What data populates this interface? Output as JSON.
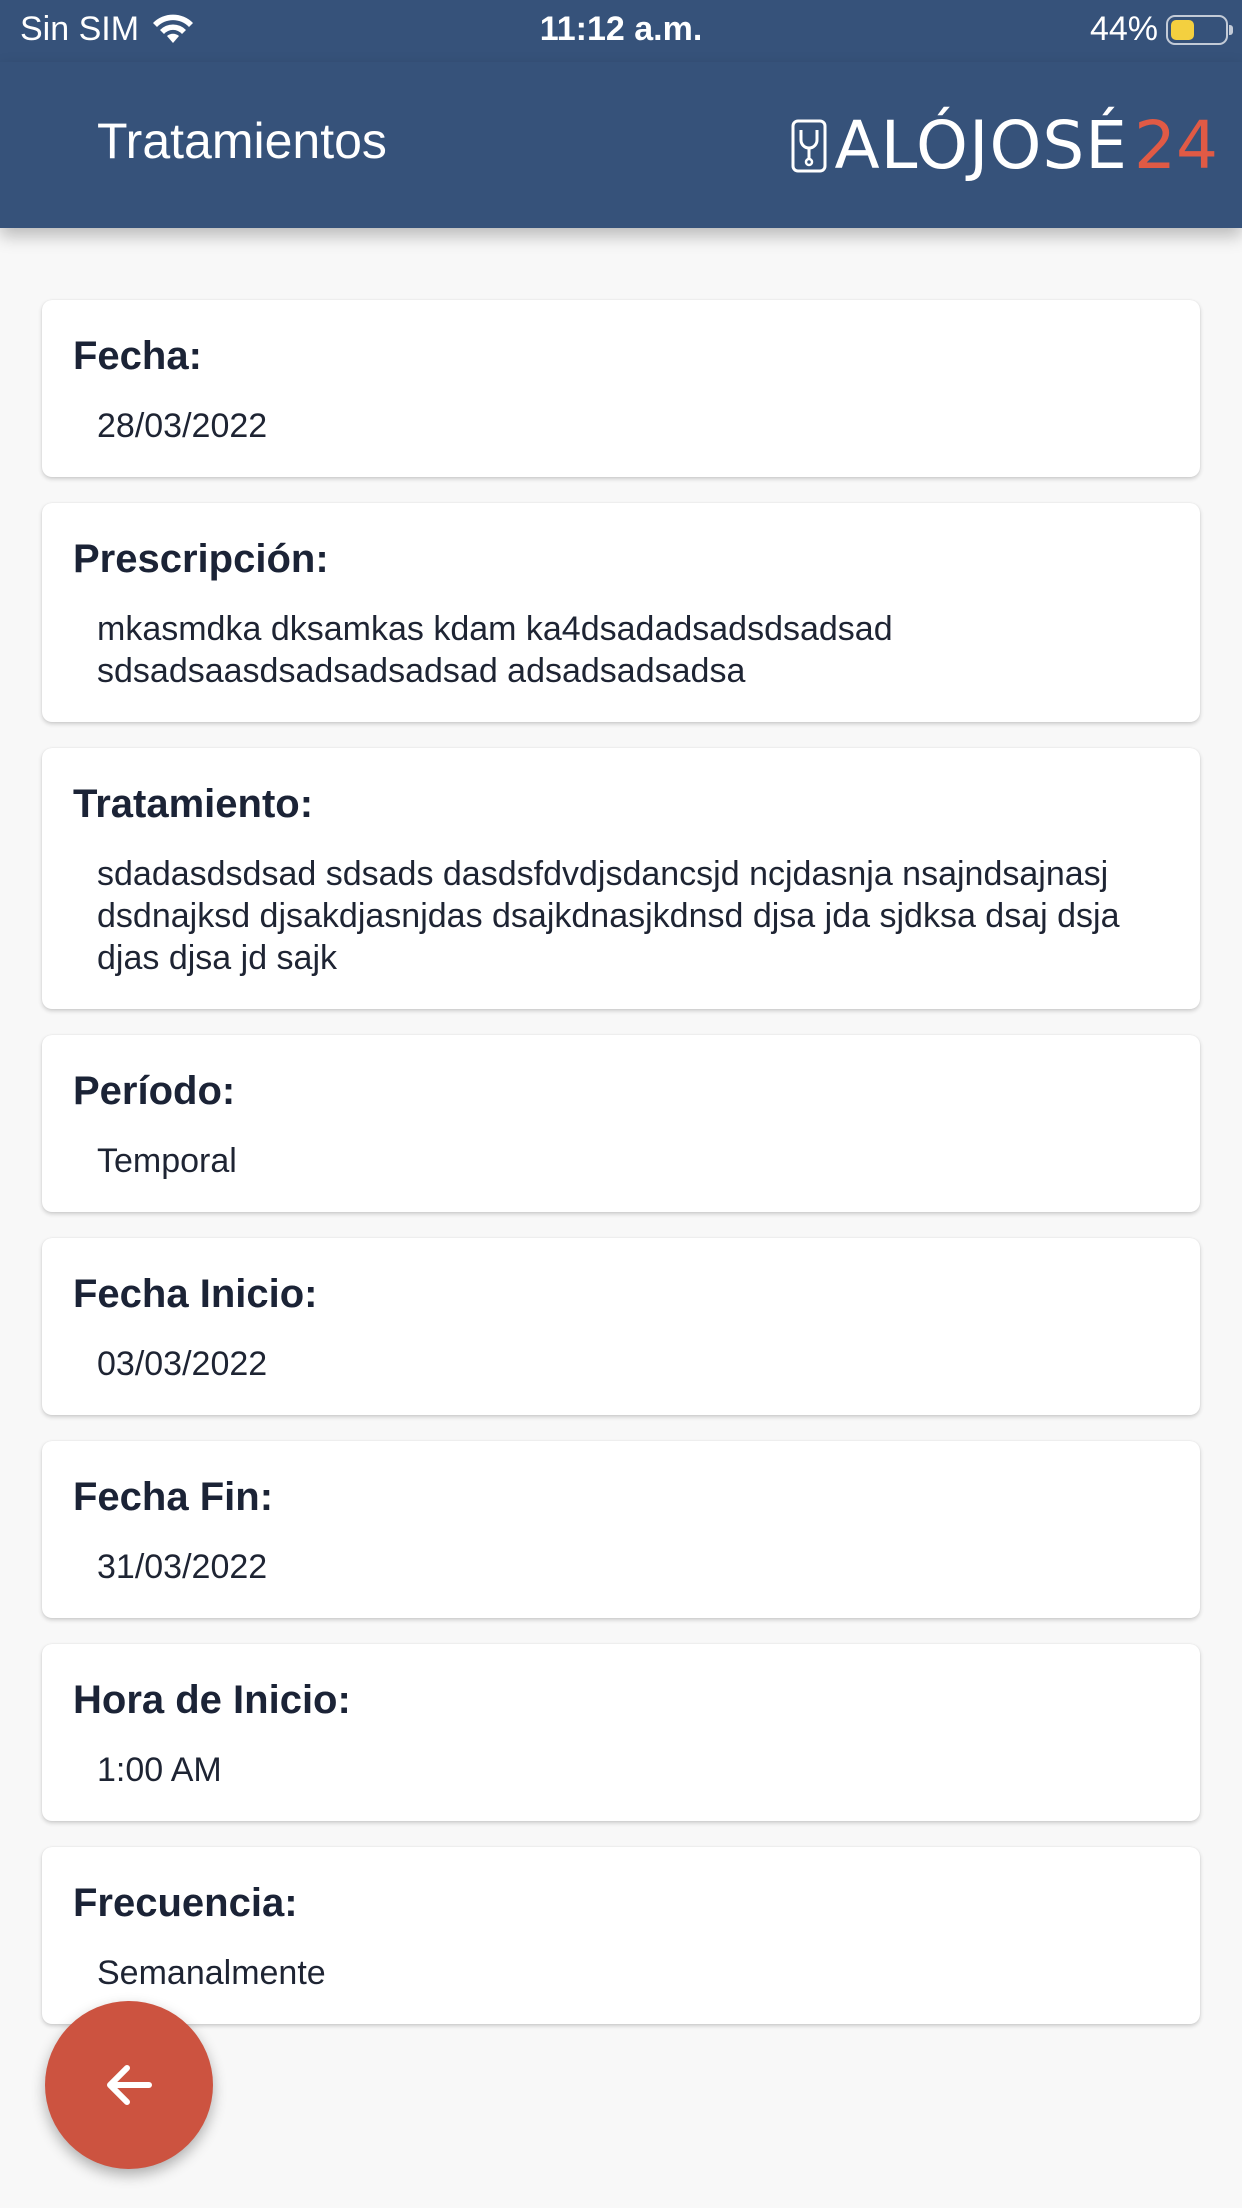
{
  "status_bar": {
    "carrier": "Sin SIM",
    "time": "11:12 a.m.",
    "battery_text": "44%",
    "battery_level": 0.44
  },
  "header": {
    "title": "Tratamientos",
    "logo_text": "ALÓJOSÉ",
    "logo_number": "24"
  },
  "colors": {
    "header_bg": "#36527a",
    "fab_bg": "#cc5340",
    "logo_accent": "#e05a45"
  },
  "cards": [
    {
      "label": "Fecha:",
      "value": "28/03/2022"
    },
    {
      "label": "Prescripción:",
      "value": "mkasmdka dksamkas kdam ka4dsadadsadsdsadsad sdsadsaasdsadsadsadsad adsadsadsadsa"
    },
    {
      "label": "Tratamiento:",
      "value": "sdadasdsdsad sdsads dasdsfdvdjsdancsjd ncjdasnja nsajndsajnasj dsdnajksd djsakdjasnjdas dsajkdnasjkdnsd djsa jda sjdksa dsaj dsja djas djsa jd sajk"
    },
    {
      "label": "Período:",
      "value": "Temporal"
    },
    {
      "label": "Fecha Inicio:",
      "value": "03/03/2022"
    },
    {
      "label": "Fecha Fin:",
      "value": "31/03/2022"
    },
    {
      "label": "Hora de Inicio:",
      "value": "1:00 AM"
    },
    {
      "label": "Frecuencia:",
      "value": "Semanalmente"
    }
  ],
  "fab": {
    "icon": "arrow-left-icon"
  }
}
